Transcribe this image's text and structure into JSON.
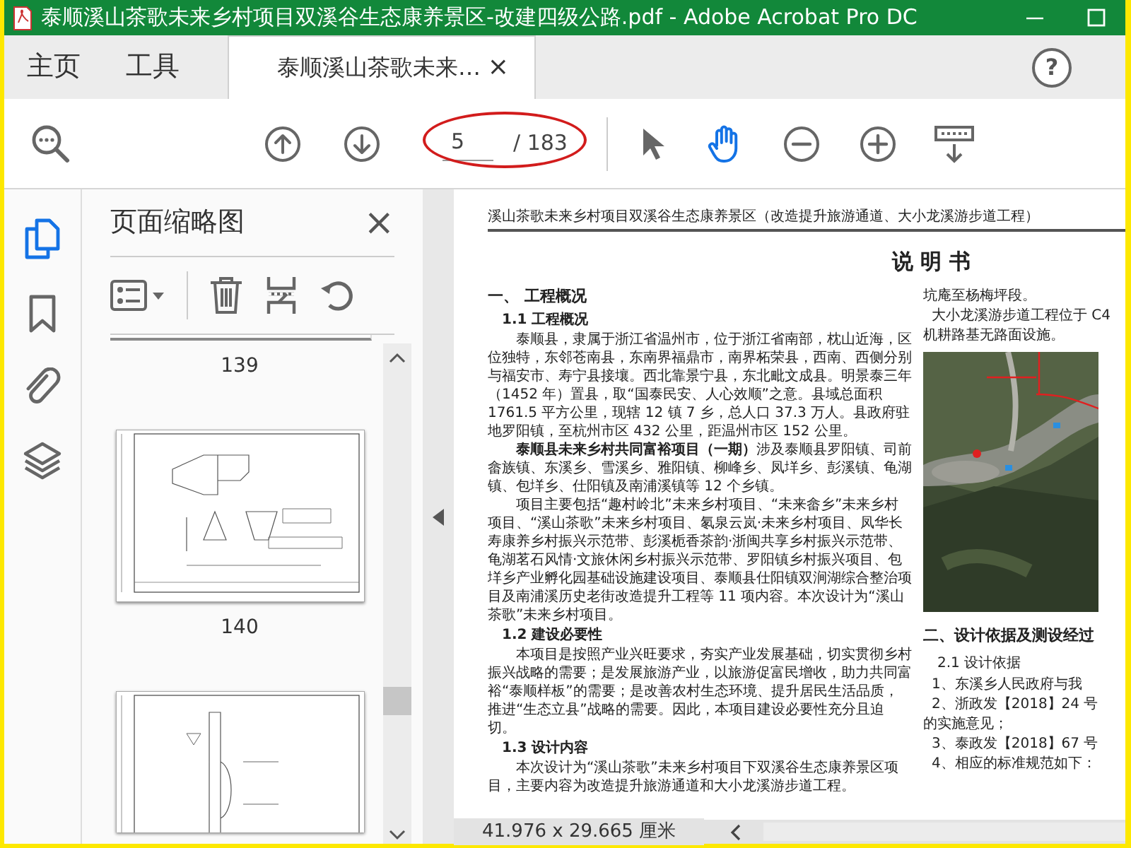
{
  "window": {
    "title": "泰顺溪山茶歌未来乡村项目双溪谷生态康养景区-改建四级公路.pdf - Adobe Acrobat Pro DC"
  },
  "tabs": [
    {
      "label": "主页",
      "kind": "nav",
      "selected": false
    },
    {
      "label": "工具",
      "kind": "nav",
      "selected": false
    },
    {
      "label": "泰顺溪山茶歌未来…",
      "kind": "document",
      "selected": true,
      "close": "×"
    }
  ],
  "help": "?",
  "toolbar": {
    "page_current": "5",
    "page_total": "/ 183",
    "circled": true,
    "tools": [
      {
        "kind": "select",
        "selected": false
      },
      {
        "kind": "hand",
        "selected": true
      },
      {
        "kind": "zoom-out",
        "selected": false
      },
      {
        "kind": "zoom-in",
        "selected": false
      },
      {
        "kind": "scroll-mode",
        "selected": false
      }
    ]
  },
  "sidebar": {
    "panels": [
      {
        "kind": "pages",
        "selected": true
      },
      {
        "kind": "bookmarks",
        "selected": false
      },
      {
        "kind": "attachments",
        "selected": false
      },
      {
        "kind": "layers",
        "selected": false
      }
    ],
    "title": "页面缩略图",
    "close": "×",
    "thumbnails": [
      {
        "kind": "cut",
        "label": "139"
      },
      {
        "kind": "plan",
        "label": "140"
      },
      {
        "kind": "elevation"
      }
    ]
  },
  "document": {
    "header": "溪山茶歌未来乡村项目双溪谷生态康养景区（改造提升旅游通道、大小龙溪游步道工程）",
    "title": "说 明 书",
    "left_column": [
      {
        "kind": "h1",
        "text": "一、 工程概况"
      },
      {
        "kind": "h2",
        "text": "1.1 工程概况"
      },
      {
        "kind": "p",
        "text": "泰顺县，隶属于浙江省温州市，位于浙江省南部，枕山近海，区位独特，东邻苍南县，东南界福鼎市，南界柘荣县，西南、西侧分别与福安市、寿宁县接壤。西北靠景宁县，东北毗文成县。明景泰三年（1452 年）置县，取“国泰民安、人心效顺”之意。县域总面积 1761.5 平方公里，现辖 12 镇 7 乡，总人口 37.3 万人。县政府驻地罗阳镇，至杭州市区 432 公里，距温州市区 152 公里。"
      },
      {
        "kind": "p",
        "text": "**泰顺县未来乡村共同富裕项目（一期）**涉及泰顺县罗阳镇、司前畲族镇、东溪乡、雪溪乡、雅阳镇、柳峰乡、凤垟乡、彭溪镇、龟湖镇、包垟乡、仕阳镇及南浦溪镇等 12 个乡镇。"
      },
      {
        "kind": "p",
        "text": "项目主要包括“趣村岭北”未来乡村项目、“未来畲乡”未来乡村项目、“溪山茶歌”未来乡村项目、氡泉云岚·未来乡村项目、凤华长寿康养乡村振兴示范带、彭溪栀香茶韵·浙闽共享乡村振兴示范带、龟湖茗石风情·文旅休闲乡村振兴示范带、罗阳镇乡村振兴项目、包垟乡产业孵化园基础设施建设项目、泰顺县仕阳镇双涧湖综合整治项目及南浦溪历史老街改造提升工程等 11 项内容。本次设计为“溪山茶歌”未来乡村项目。"
      },
      {
        "kind": "h2",
        "text": "1.2 建设必要性"
      },
      {
        "kind": "p",
        "text": "本项目是按照产业兴旺要求，夯实产业发展基础，切实贯彻乡村振兴战略的需要；是发展旅游产业，以旅游促富民增收，助力共同富裕“泰顺样板”的需要；是改善农村生态环境、提升居民生活品质，推进“生态立县”战略的需要。因此，本项目建设必要性充分且迫切。"
      },
      {
        "kind": "h2",
        "text": "1.3 设计内容"
      },
      {
        "kind": "p",
        "text": "本次设计为“溪山茶歌”未来乡村项目下双溪谷生态康养景区项目，主要内容为改造提升旅游通道和大小龙溪游步道工程。"
      }
    ],
    "right_column": [
      {
        "kind": "line",
        "text": "坑庵至杨梅坪段。"
      },
      {
        "kind": "p",
        "text": "大小龙溪游步道工程位于 C4"
      },
      {
        "kind": "line",
        "text": "机耕路基无路面设施。"
      },
      {
        "kind": "picture"
      },
      {
        "kind": "h1",
        "text": "二、设计依据及测设经过"
      },
      {
        "kind": "h2",
        "text": "2.1 设计依据"
      },
      {
        "kind": "p",
        "text": "1、东溪乡人民政府与我"
      },
      {
        "kind": "p",
        "text": "2、浙政发【2018】24 号"
      },
      {
        "kind": "line",
        "text": "的实施意见；"
      },
      {
        "kind": "p",
        "text": "3、泰政发【2018】67 号"
      },
      {
        "kind": "p",
        "text": "4、相应的标准规范如下："
      }
    ]
  },
  "status_bar": {
    "size": "41.976 x 29.665 厘米"
  }
}
